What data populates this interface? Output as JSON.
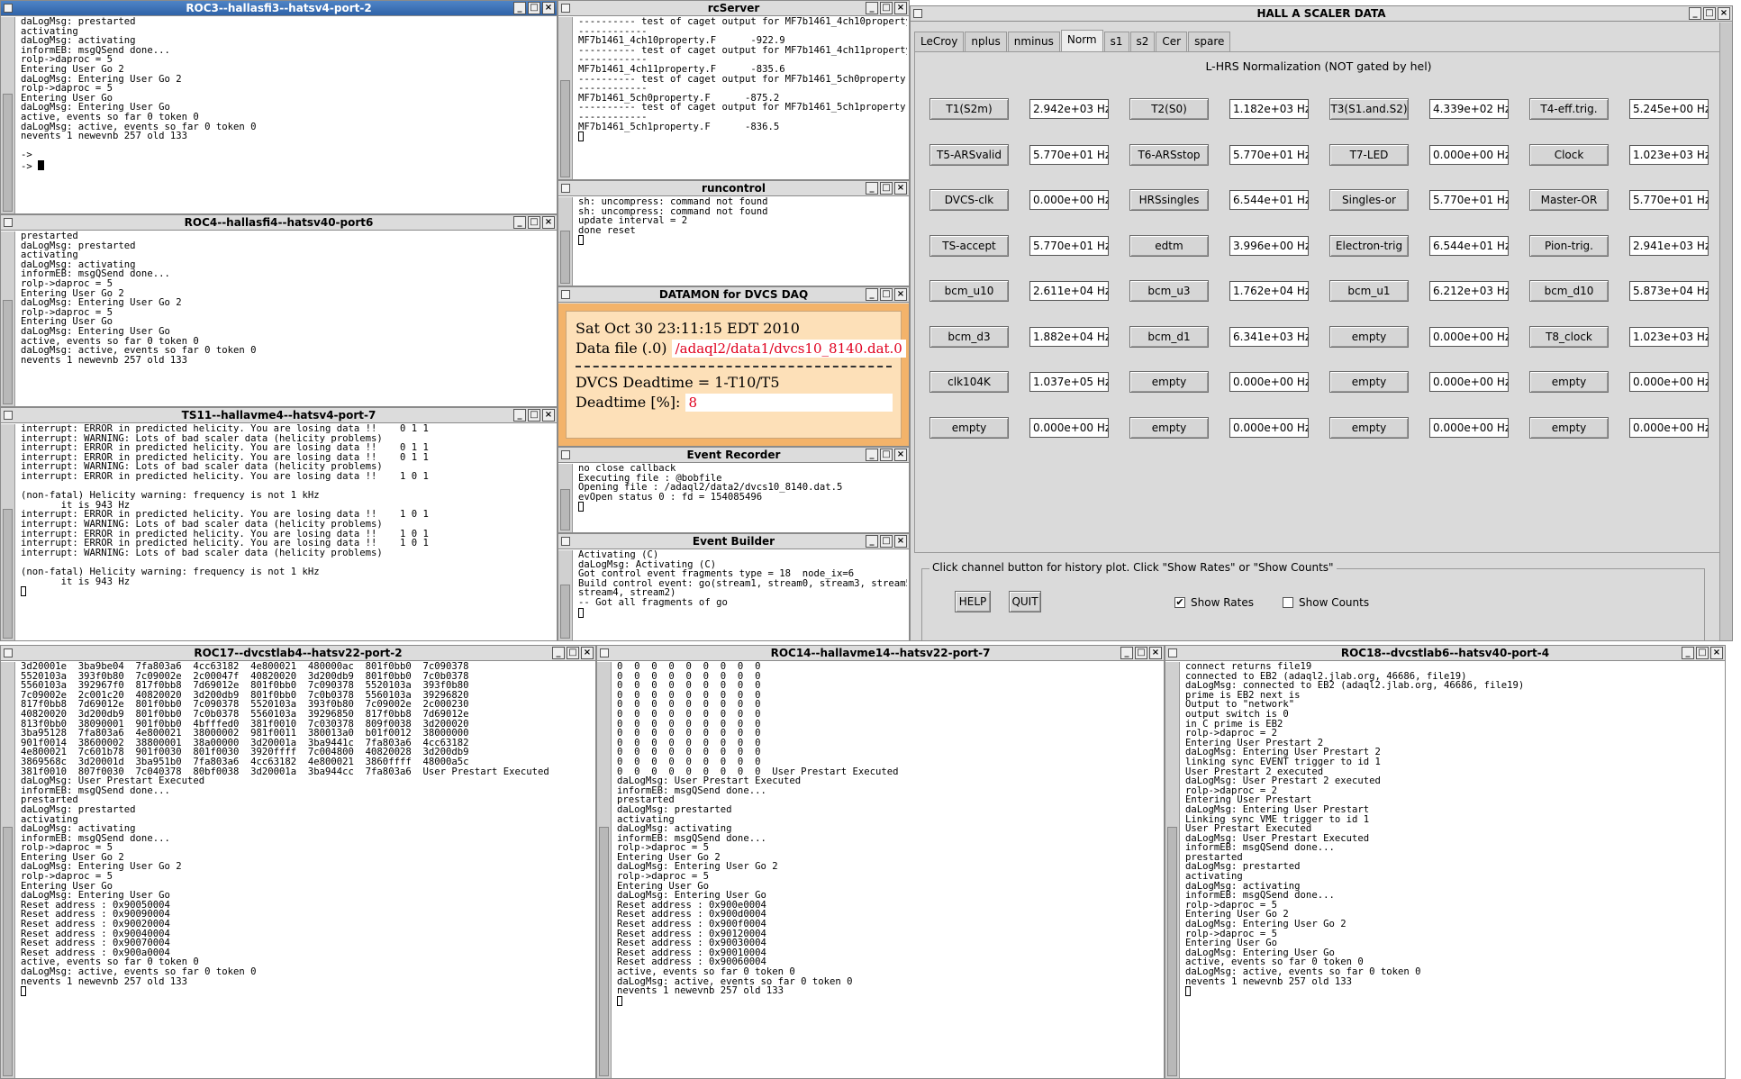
{
  "roc3": {
    "title": "ROC3--hallasfi3--hatsv4-port-2",
    "lines": [
      "daLogMsg: prestarted",
      "activating",
      "daLogMsg: activating",
      "informEB: msgQSend done...",
      "rolp->daproc = 5",
      "Entering User Go 2",
      "daLogMsg: Entering User Go 2",
      "rolp->daproc = 5",
      "Entering User Go",
      "daLogMsg: Entering User Go",
      "active, events so far 0 token 0",
      "daLogMsg: active, events so far 0 token 0",
      "nevents 1 newevnb 257 old 133",
      "",
      "->"
    ],
    "prompt": "->"
  },
  "roc4": {
    "title": "ROC4--hallasfi4--hatsv40-port6",
    "lines": [
      "prestarted",
      "daLogMsg: prestarted",
      "activating",
      "daLogMsg: activating",
      "informEB: msgQSend done...",
      "rolp->daproc = 5",
      "Entering User Go 2",
      "daLogMsg: Entering User Go 2",
      "rolp->daproc = 5",
      "Entering User Go",
      "daLogMsg: Entering User Go",
      "active, events so far 0 token 0",
      "daLogMsg: active, events so far 0 token 0",
      "nevents 1 newevnb 257 old 133"
    ]
  },
  "ts11": {
    "title": "TS11--hallavme4--hatsv4-port-7",
    "lines": [
      "interrupt: ERROR in predicted helicity. You are losing data !!    0 1 1",
      "interrupt: WARNING: Lots of bad scaler data (helicity problems)",
      "interrupt: ERROR in predicted helicity. You are losing data !!    0 1 1",
      "interrupt: ERROR in predicted helicity. You are losing data !!    0 1 1",
      "interrupt: WARNING: Lots of bad scaler data (helicity problems)",
      "interrupt: ERROR in predicted helicity. You are losing data !!    1 0 1",
      "",
      "(non-fatal) Helicity warning: frequency is not 1 kHz",
      "       it is 943 Hz",
      "interrupt: ERROR in predicted helicity. You are losing data !!    1 0 1",
      "interrupt: WARNING: Lots of bad scaler data (helicity problems)",
      "interrupt: ERROR in predicted helicity. You are losing data !!    1 0 1",
      "interrupt: ERROR in predicted helicity. You are losing data !!    1 0 1",
      "interrupt: WARNING: Lots of bad scaler data (helicity problems)",
      "",
      "(non-fatal) Helicity warning: frequency is not 1 kHz",
      "       it is 943 Hz"
    ]
  },
  "rcserver": {
    "title": "rcServer",
    "lines": [
      "---------- test of caget output for MF7b1461_4ch10property.F",
      "------------",
      "MF7b1461_4ch10property.F      -922.9",
      "---------- test of caget output for MF7b1461_4ch11property.F",
      "------------",
      "MF7b1461_4ch11property.F      -835.6",
      "---------- test of caget output for MF7b1461_5ch0property.F",
      "------------",
      "MF7b1461_5ch0property.F      -875.2",
      "---------- test of caget output for MF7b1461_5ch1property.F",
      "------------",
      "MF7b1461_5ch1property.F      -836.5"
    ]
  },
  "runcontrol": {
    "title": "runcontrol",
    "lines": [
      "sh: uncompress: command not found",
      "sh: uncompress: command not found",
      "update interval = 2",
      "done reset"
    ]
  },
  "datamon": {
    "title": "DATAMON  for DVCS DAQ",
    "date": "Sat Oct 30 23:11:15 EDT 2010",
    "file_label": "Data file (.0)",
    "file_value": "/adaql2/data1/dvcs10_8140.dat.0",
    "deadtime_title": "DVCS Deadtime = 1-T10/T5",
    "deadtime_label": "Deadtime [%]:",
    "deadtime_value": "8"
  },
  "recorder": {
    "title": "Event Recorder",
    "lines": [
      "no close callback",
      "Executing file : @bobfile",
      "Opening file : /adaql2/data2/dvcs10_8140.dat.5",
      "evOpen status 0 : fd = 154085496"
    ]
  },
  "builder": {
    "title": "Event Builder",
    "lines": [
      "Activating (C)",
      "daLogMsg: Activating (C)",
      "Got control event fragments type = 18  node_ix=6",
      "Build control event: go(stream1, stream0, stream3, stream5,",
      "stream4, stream2)",
      "-- Got all fragments of go"
    ]
  },
  "scaler": {
    "title": "HALL  A  SCALER  DATA",
    "tabs": [
      "LeCroy",
      "nplus",
      "nminus",
      "Norm",
      "s1",
      "s2",
      "Cer",
      "spare"
    ],
    "header": "L-HRS Normalization (NOT gated by hel)",
    "rows": [
      [
        {
          "l": "T1(S2m)",
          "v": "2.942e+03 Hz"
        },
        {
          "l": "T2(S0)",
          "v": "1.182e+03 Hz"
        },
        {
          "l": "T3(S1.and.S2)",
          "v": "4.339e+02 Hz"
        },
        {
          "l": "T4-eff.trig.",
          "v": "5.245e+00 Hz"
        }
      ],
      [
        {
          "l": "T5-ARSvalid",
          "v": "5.770e+01 Hz"
        },
        {
          "l": "T6-ARSstop",
          "v": "5.770e+01 Hz"
        },
        {
          "l": "T7-LED",
          "v": "0.000e+00 Hz"
        },
        {
          "l": "Clock",
          "v": "1.023e+03 Hz"
        }
      ],
      [
        {
          "l": "DVCS-clk",
          "v": "0.000e+00 Hz"
        },
        {
          "l": "HRSsingles",
          "v": "6.544e+01 Hz"
        },
        {
          "l": "Singles-or",
          "v": "5.770e+01 Hz"
        },
        {
          "l": "Master-OR",
          "v": "5.770e+01 Hz"
        }
      ],
      [
        {
          "l": "TS-accept",
          "v": "5.770e+01 Hz"
        },
        {
          "l": "edtm",
          "v": "3.996e+00 Hz"
        },
        {
          "l": "Electron-trig",
          "v": "6.544e+01 Hz"
        },
        {
          "l": "Pion-trig.",
          "v": "2.941e+03 Hz"
        }
      ],
      [
        {
          "l": "bcm_u10",
          "v": "2.611e+04 Hz"
        },
        {
          "l": "bcm_u3",
          "v": "1.762e+04 Hz"
        },
        {
          "l": "bcm_u1",
          "v": "6.212e+03 Hz"
        },
        {
          "l": "bcm_d10",
          "v": "5.873e+04 Hz"
        }
      ],
      [
        {
          "l": "bcm_d3",
          "v": "1.882e+04 Hz"
        },
        {
          "l": "bcm_d1",
          "v": "6.341e+03 Hz"
        },
        {
          "l": "empty",
          "v": "0.000e+00 Hz"
        },
        {
          "l": "T8_clock",
          "v": "1.023e+03 Hz"
        }
      ],
      [
        {
          "l": "clk104K",
          "v": "1.037e+05 Hz"
        },
        {
          "l": "empty",
          "v": "0.000e+00 Hz"
        },
        {
          "l": "empty",
          "v": "0.000e+00 Hz"
        },
        {
          "l": "empty",
          "v": "0.000e+00 Hz"
        }
      ],
      [
        {
          "l": "empty",
          "v": "0.000e+00 Hz"
        },
        {
          "l": "empty",
          "v": "0.000e+00 Hz"
        },
        {
          "l": "empty",
          "v": "0.000e+00 Hz"
        },
        {
          "l": "empty",
          "v": "0.000e+00 Hz"
        }
      ]
    ],
    "hint": "Click channel button for history plot.  Click \"Show Rates\" or \"Show Counts\"",
    "help_label": "HELP",
    "quit_label": "QUIT",
    "show_rates_label": "Show Rates",
    "show_rates_checked": true,
    "show_counts_label": "Show Counts",
    "show_counts_checked": false
  },
  "roc17": {
    "title": "ROC17--dvcstlab4--hatsv22-port-2",
    "lines": [
      "3d20001e  3ba9be04  7fa803a6  4cc63182  4e800021  480000ac  801f0bb0  7c090378",
      "5520103a  393f0b80  7c09002e  2c00047f  40820020  3d200db9  801f0bb0  7c0b0378",
      "5560103a  392967f0  817f0bb8  7d69012e  801f0bb0  7c090378  5520103a  393f0b80",
      "7c09002e  2c001c20  40820020  3d200db9  801f0bb0  7c0b0378  5560103a  39296820",
      "817f0bb8  7d69012e  801f0bb0  7c090378  5520103a  393f0b80  7c09002e  2c000230",
      "40820020  3d200db9  801f0bb0  7c0b0378  5560103a  39296850  817f0bb8  7d69012e",
      "813f0bb0  38090001  901f0bb0  4bfffed0  381f0010  7c030378  809f0038  3d200020",
      "3ba95128  7fa803a6  4e800021  38000002  981f0011  380013a0  b01f0012  38000000",
      "901f0014  38600002  38800001  38a00000  3d20001a  3ba9441c  7fa803a6  4cc63182",
      "4e800021  7c601b78  901f0030  801f0030  3920ffff  7c004800  40820028  3d200db9",
      "3869568c  3d20001d  3ba951b0  7fa803a6  4cc63182  4e800021  3860ffff  48000a5c",
      "381f0010  807f0030  7c040378  80bf0038  3d20001a  3ba944cc  7fa803a6  User Prestart Executed",
      "daLogMsg: User Prestart Executed",
      "informEB: msgQSend done...",
      "prestarted",
      "daLogMsg: prestarted",
      "activating",
      "daLogMsg: activating",
      "informEB: msgQSend done...",
      "rolp->daproc = 5",
      "Entering User Go 2",
      "daLogMsg: Entering User Go 2",
      "rolp->daproc = 5",
      "Entering User Go",
      "daLogMsg: Entering User Go",
      "Reset address : 0x90050004",
      "Reset address : 0x90090004",
      "Reset address : 0x90020004",
      "Reset address : 0x90040004",
      "Reset address : 0x90070004",
      "Reset address : 0x900a0004",
      "active, events so far 0 token 0",
      "daLogMsg: active, events so far 0 token 0",
      "nevents 1 newevnb 257 old 133"
    ]
  },
  "roc14": {
    "title": "ROC14--hallavme14--hatsv22-port-7",
    "lines": [
      "0  0  0  0  0  0  0  0  0",
      "0  0  0  0  0  0  0  0  0",
      "0  0  0  0  0  0  0  0  0",
      "0  0  0  0  0  0  0  0  0",
      "0  0  0  0  0  0  0  0  0",
      "0  0  0  0  0  0  0  0  0",
      "0  0  0  0  0  0  0  0  0",
      "0  0  0  0  0  0  0  0  0",
      "0  0  0  0  0  0  0  0  0",
      "0  0  0  0  0  0  0  0  0",
      "0  0  0  0  0  0  0  0  0",
      "0  0  0  0  0  0  0  0  0  User Prestart Executed",
      "daLogMsg: User Prestart Executed",
      "informEB: msgQSend done...",
      "prestarted",
      "daLogMsg: prestarted",
      "activating",
      "daLogMsg: activating",
      "informEB: msgQSend done...",
      "rolp->daproc = 5",
      "Entering User Go 2",
      "daLogMsg: Entering User Go 2",
      "rolp->daproc = 5",
      "Entering User Go",
      "daLogMsg: Entering User Go",
      "Reset address : 0x900e0004",
      "Reset address : 0x900d0004",
      "Reset address : 0x900f0004",
      "Reset address : 0x90120004",
      "Reset address : 0x90030004",
      "Reset address : 0x90010004",
      "Reset address : 0x90060004",
      "active, events so far 0 token 0",
      "daLogMsg: active, events so far 0 token 0",
      "nevents 1 newevnb 257 old 133"
    ]
  },
  "roc18": {
    "title": "ROC18--dvcstlab6--hatsv40-port-4",
    "lines": [
      "connect returns file19",
      "connected to EB2 (adaql2.jlab.org, 46686, file19)",
      "daLogMsg: connected to EB2 (adaql2.jlab.org, 46686, file19)",
      "prime is EB2 next is",
      "Output to \"network\"",
      "output switch is 0",
      "in C prime is EB2",
      "rolp->daproc = 2",
      "Entering User Prestart 2",
      "daLogMsg: Entering User Prestart 2",
      "linking sync EVENT trigger to id 1",
      "User Prestart 2 executed",
      "daLogMsg: User Prestart 2 executed",
      "rolp->daproc = 2",
      "Entering User Prestart",
      "daLogMsg: Entering User Prestart",
      "Linking sync VME trigger to id 1",
      "User Prestart Executed",
      "daLogMsg: User Prestart Executed",
      "informEB: msgQSend done...",
      "prestarted",
      "daLogMsg: prestarted",
      "activating",
      "daLogMsg: activating",
      "informEB: msgQSend done...",
      "rolp->daproc = 5",
      "Entering User Go 2",
      "daLogMsg: Entering User Go 2",
      "rolp->daproc = 5",
      "Entering User Go",
      "daLogMsg: Entering User Go",
      "active, events so far 0 token 0",
      "daLogMsg: active, events so far 0 token 0",
      "nevents 1 newevnb 257 old 133"
    ]
  }
}
